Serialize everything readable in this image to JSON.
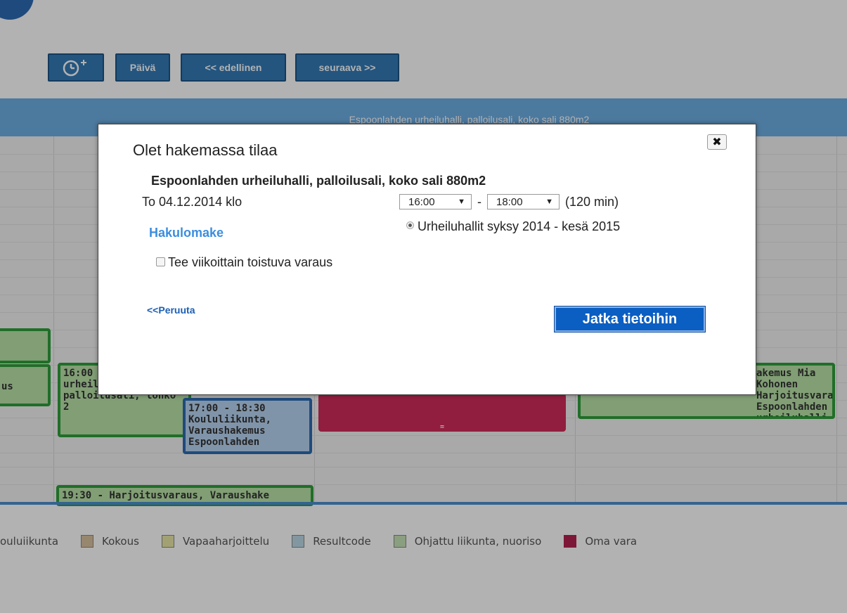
{
  "toolbar": {
    "clock_icon": "clock-plus-icon",
    "day_label": "Päivä",
    "prev_label": "<< edellinen",
    "next_label": "seuraava >>"
  },
  "hall_header": "Espoonlahden urheiluhalli, palloilusali, koko sali 880m2",
  "events": [
    {
      "text": "us"
    },
    {
      "text": "16:00 Espoonlahden urheiluhalli, palloilusali, lohko 2"
    },
    {
      "text": "17:00 - 18:30 Koululiikunta, Varaushakemus Espoonlahden"
    },
    {
      "text": "="
    },
    {
      "text": "akemus Mia Kohonen Harjoitusvaraus Espoonlahden urheiluhalli"
    },
    {
      "text": "19:30 - Harjoitusvaraus, Varaushake"
    }
  ],
  "legend": [
    {
      "label": "ouluiikunta",
      "color": "#ffffff"
    },
    {
      "label": "Kokous",
      "color": "#d8c2a0"
    },
    {
      "label": "Vapaaharjoittelu",
      "color": "#e9e7a6"
    },
    {
      "label": "Resultcode",
      "color": "#bcd9e6"
    },
    {
      "label": "Ohjattu liikunta, nuoriso",
      "color": "#c6e3b8"
    },
    {
      "label": "Oma vara",
      "color": "#b3214f"
    }
  ],
  "modal": {
    "title": "Olet hakemassa tilaa",
    "close_label": "✖",
    "hall_name": "Espoonlahden urheiluhalli, palloilusali, koko sali 880m2",
    "date_text": "To 04.12.2014 klo",
    "start_time": "16:00",
    "end_time": "18:00",
    "dash": "-",
    "duration": "(120 min)",
    "form_link": "Hakulomake",
    "season_option": "Urheiluhallit syksy 2014 - kesä 2015",
    "repeat_label": "Tee viikoittain toistuva varaus",
    "cancel_link": "<<Peruuta",
    "continue_label": "Jatka tietoihin"
  }
}
